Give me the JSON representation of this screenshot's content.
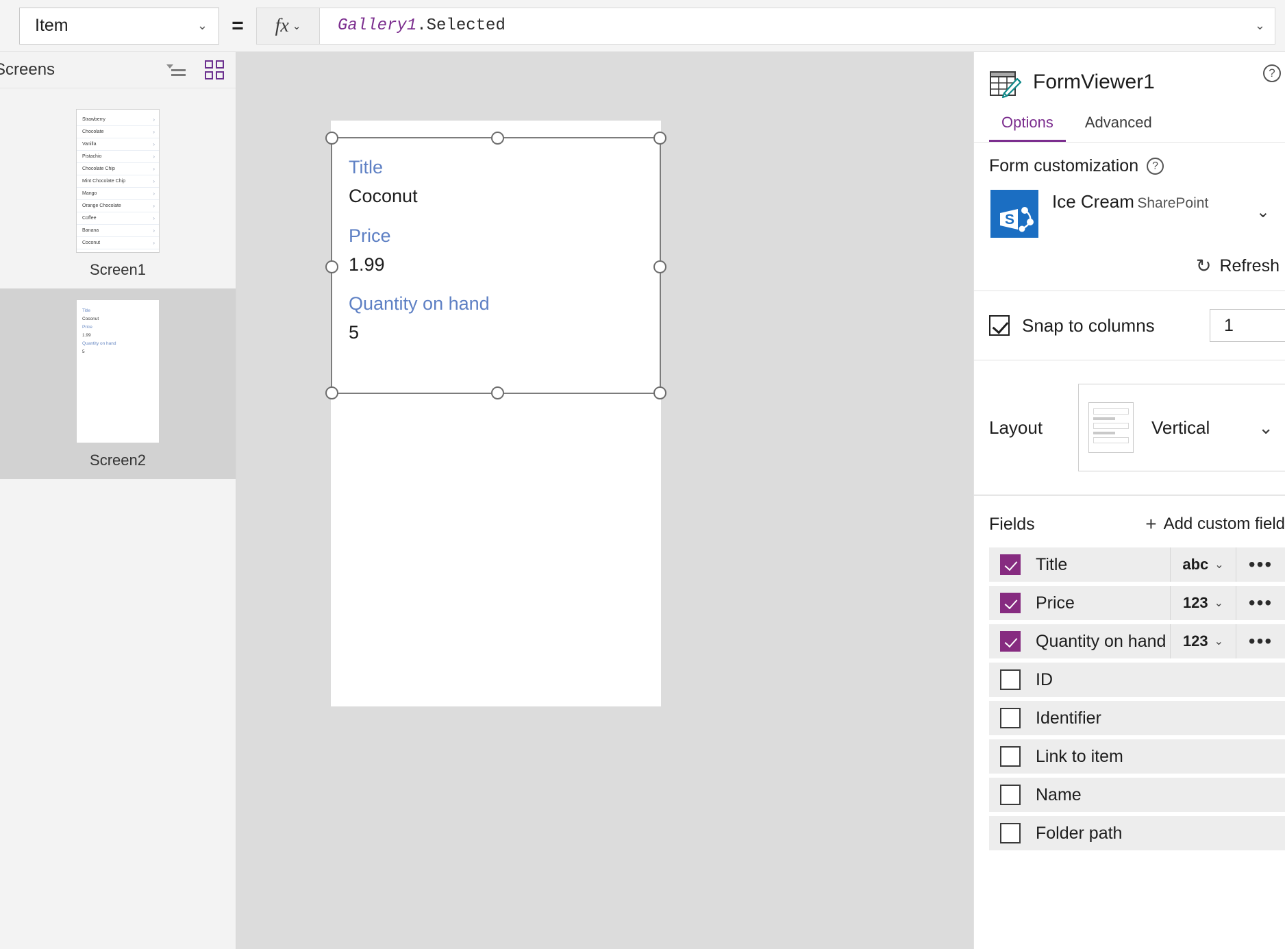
{
  "formula_bar": {
    "property_label": "Item",
    "equals": "=",
    "fx_label": "fx",
    "formula_object": "Gallery1",
    "formula_dot": ".",
    "formula_property": "Selected",
    "chevron": "⌄"
  },
  "left_panel": {
    "title": "Screens",
    "treeview_icon": "tree-view-icon",
    "gridview_icon": "grid-view-icon",
    "screens": [
      {
        "label": "Screen1",
        "selected": false,
        "type": "gallery",
        "gallery_items": [
          "Strawberry",
          "Chocolate",
          "Vanilla",
          "Pistachio",
          "Chocolate Chip",
          "Mint Chocolate Chip",
          "Mango",
          "Orange Chocolate",
          "Coffee",
          "Banana",
          "Coconut"
        ],
        "item_arrow": "›"
      },
      {
        "label": "Screen2",
        "selected": true,
        "type": "form",
        "form_lines": [
          {
            "kind": "label",
            "text": "Title"
          },
          {
            "kind": "value",
            "text": "Coconut"
          },
          {
            "kind": "label",
            "text": "Price"
          },
          {
            "kind": "value",
            "text": "1.99"
          },
          {
            "kind": "label",
            "text": "Quantity on hand"
          },
          {
            "kind": "value",
            "text": "5"
          }
        ]
      }
    ]
  },
  "canvas": {
    "form_fields": [
      {
        "label": "Title",
        "value": "Coconut"
      },
      {
        "label": "Price",
        "value": "1.99"
      },
      {
        "label": "Quantity on hand",
        "value": "5"
      }
    ]
  },
  "right_panel": {
    "control_name": "FormViewer1",
    "control_icon": "form-viewer-icon",
    "help_icon": "?",
    "tabs": [
      {
        "label": "Options",
        "active": true
      },
      {
        "label": "Advanced",
        "active": false
      }
    ],
    "form_customization": {
      "title": "Form customization",
      "help_icon": "?",
      "data_source": {
        "name": "Ice Cream",
        "account_redacted": "",
        "connector": "SharePoint",
        "icon": "sharepoint-icon",
        "chevron": "⌄"
      },
      "refresh": {
        "label": "Refresh",
        "icon": "refresh-icon"
      }
    },
    "snap_to_columns": {
      "label": "Snap to columns",
      "checked": true,
      "columns_value": "1",
      "chevron": "⌄"
    },
    "layout": {
      "label": "Layout",
      "value": "Vertical",
      "preview_icon": "vertical-layout-icon",
      "chevron": "⌄"
    },
    "fields": {
      "title": "Fields",
      "add_label": "Add custom field",
      "add_icon": "plus-icon",
      "more_icon": "•••",
      "rows": [
        {
          "name": "Title",
          "checked": true,
          "type": "abc",
          "chevron": "⌄",
          "more": "•••"
        },
        {
          "name": "Price",
          "checked": true,
          "type": "123",
          "chevron": "⌄",
          "more": "•••"
        },
        {
          "name": "Quantity on hand",
          "checked": true,
          "type": "123",
          "chevron": "⌄",
          "more": "•••"
        },
        {
          "name": "ID",
          "checked": false,
          "type": "",
          "chevron": "",
          "more": ""
        },
        {
          "name": "Identifier",
          "checked": false,
          "type": "",
          "chevron": "",
          "more": ""
        },
        {
          "name": "Link to item",
          "checked": false,
          "type": "",
          "chevron": "",
          "more": ""
        },
        {
          "name": "Name",
          "checked": false,
          "type": "",
          "chevron": "",
          "more": ""
        },
        {
          "name": "Folder path",
          "checked": false,
          "type": "",
          "chevron": "",
          "more": ""
        }
      ]
    }
  },
  "colors": {
    "accent_purple": "#7b2d8e",
    "checkbox_purple": "#862b80",
    "field_label_blue": "#5e80c4",
    "sharepoint_blue": "#1b6ec2",
    "canvas_gray": "#dcdcdc"
  }
}
